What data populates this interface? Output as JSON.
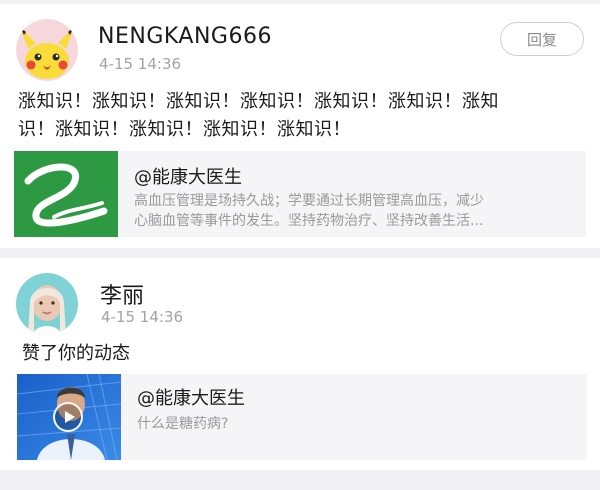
{
  "feed": [
    {
      "username": "NENGKANG666",
      "time": "4-15 14:36",
      "reply_label": "回复",
      "avatar_icon": "pikachu-avatar-icon",
      "body_line1": "涨知识！涨知识！涨知识！涨知识！涨知识！涨知识！涨知",
      "body_line2": "识！涨知识！涨知识！涨知识！涨知识！",
      "share": {
        "title": "@能康大医生",
        "desc_line1": "高血压管理是场持久战；学要通过长期管理高血压，减少",
        "desc_line2": "心脑血管等事件的发生。坚持药物治疗、坚持改善生活...",
        "thumb_icon": "nengkang-logo-icon",
        "thumb_color": "#2d9a43"
      }
    },
    {
      "username": "李丽",
      "time": "4-15 14:36",
      "avatar_icon": "user-photo-avatar-icon",
      "body": "赞了你的动态",
      "share": {
        "title": "@能康大医生",
        "desc": "什么是糖药病?",
        "thumb_icon": "video-thumbnail-icon",
        "play_icon": "play-icon",
        "thumb_color": "#1e63c9"
      }
    }
  ],
  "colors": {
    "background": "#f1f1f3",
    "card": "#ffffff",
    "share_bg": "#f5f5f7",
    "secondary_text": "#9a9a9a"
  }
}
